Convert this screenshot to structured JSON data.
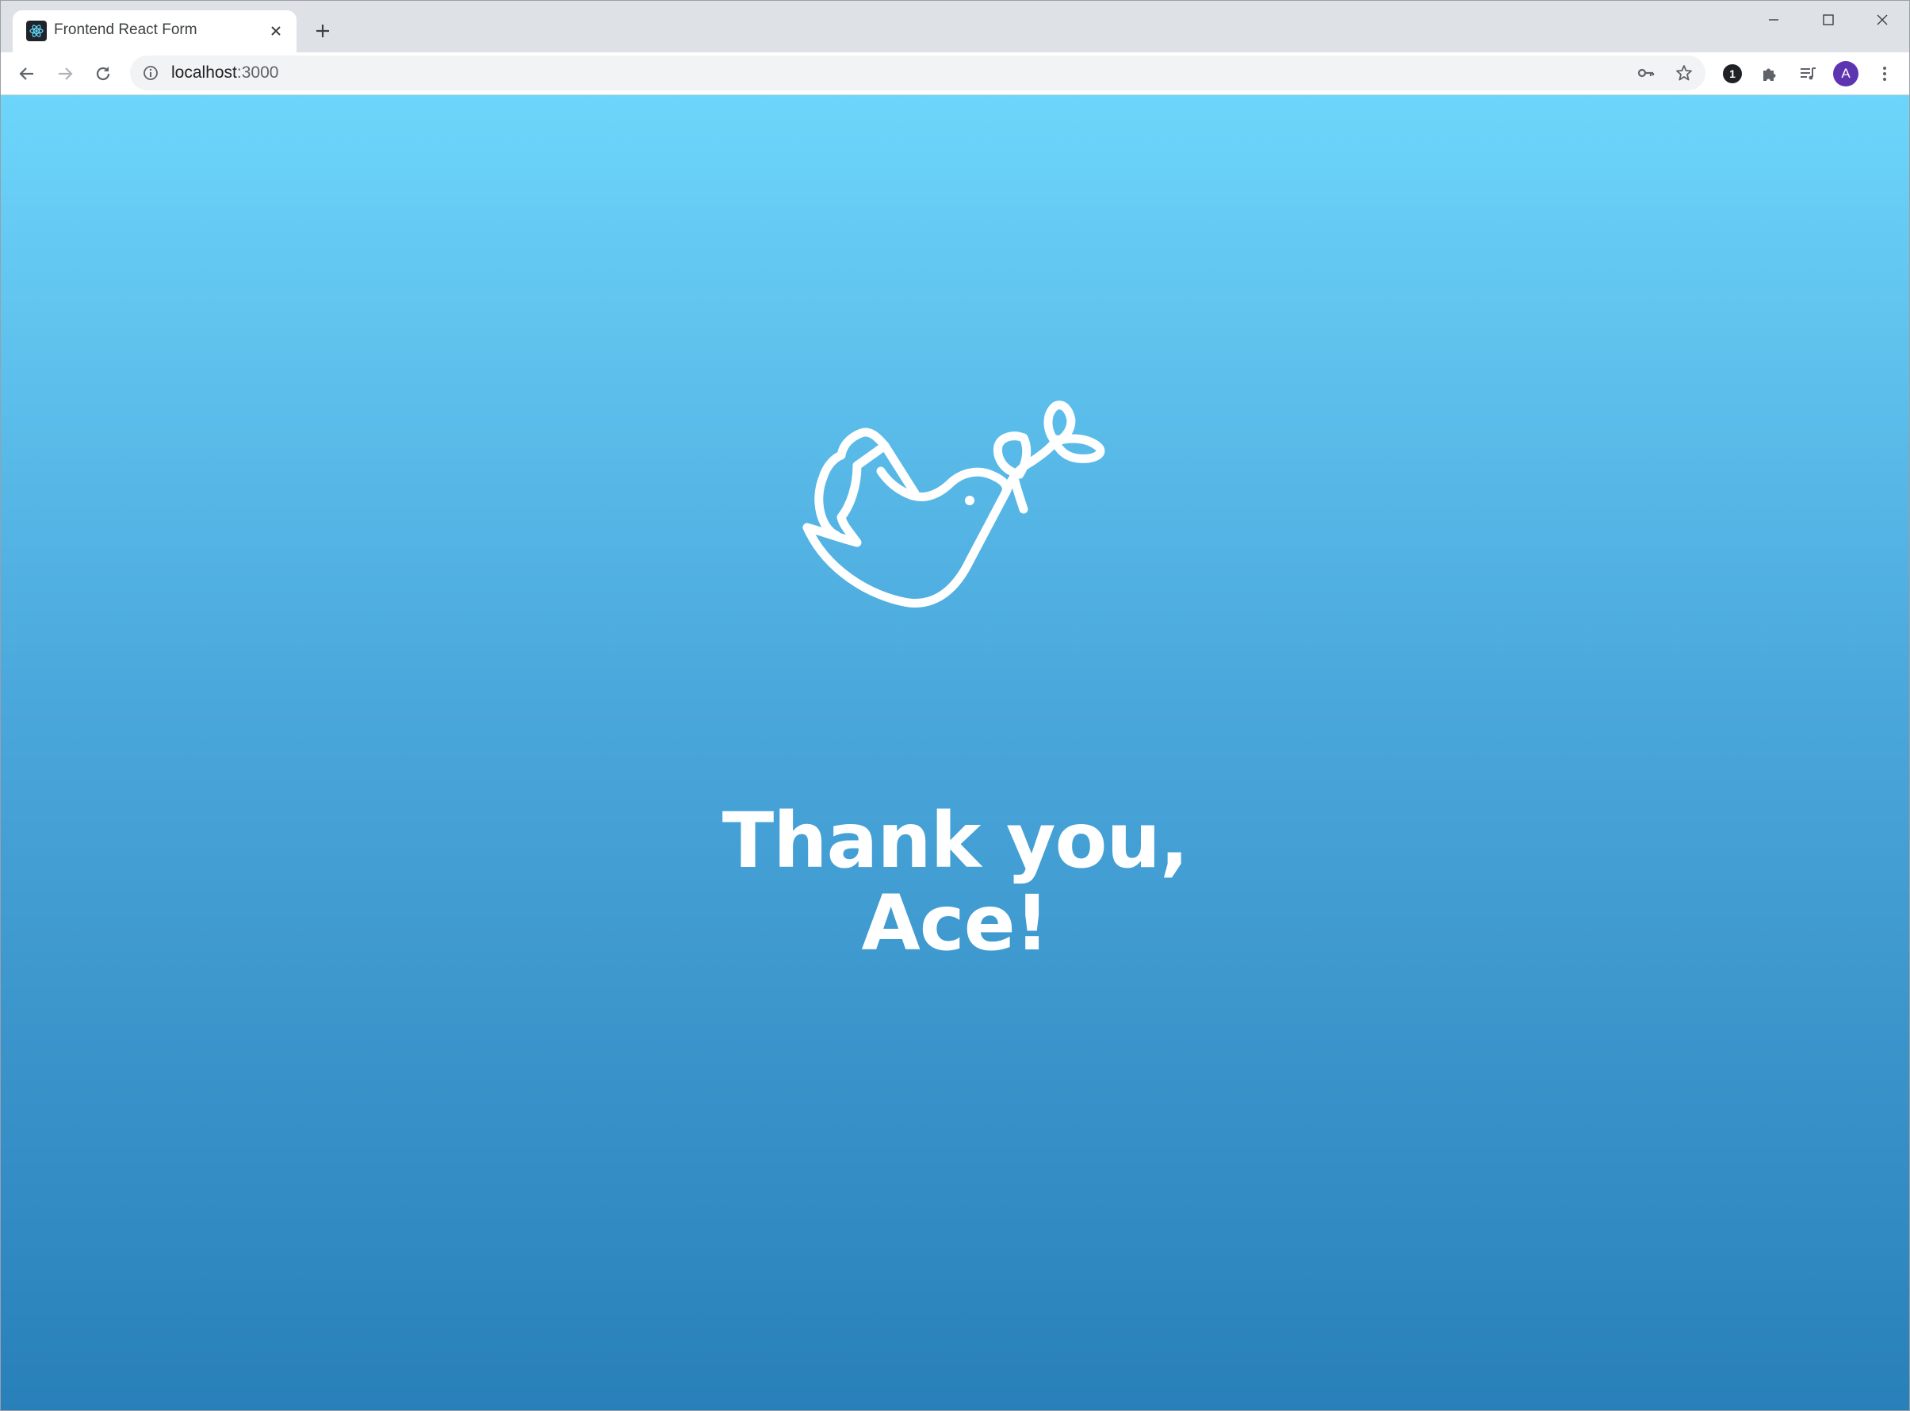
{
  "browser": {
    "tab": {
      "title": "Frontend React Form",
      "favicon": "react-logo-icon"
    },
    "new_tab": "plus-icon",
    "address_bar": {
      "host": "localhost",
      "port": ":3000"
    },
    "toolbar_icons": [
      "back-arrow-icon",
      "forward-arrow-icon",
      "reload-icon",
      "info-icon",
      "key-icon",
      "star-icon",
      "extension-1-icon",
      "puzzle-icon",
      "media-queue-icon",
      "profile-avatar",
      "kebab-menu-icon"
    ],
    "extension_badge": "1",
    "profile_initial": "A",
    "window_controls": [
      "minimize-icon",
      "maximize-icon",
      "close-icon"
    ]
  },
  "page": {
    "illustration": "dove-with-olive-branch-icon",
    "heading_line1": "Thank you,",
    "heading_line2": "Ace!",
    "gradient_top": "#6dd5fa",
    "gradient_bottom": "#2980b9"
  }
}
